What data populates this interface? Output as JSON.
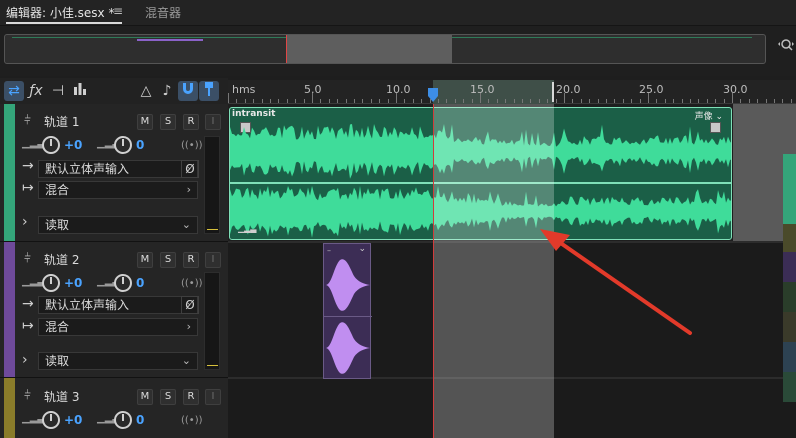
{
  "tabs": {
    "editor_label": "编辑器: 小佳.sesx *",
    "menu_icon": "≡",
    "mixer_label": "混音器"
  },
  "toolbar": {
    "icons": [
      "swap-icon",
      "fx-icon",
      "send-icon",
      "eq-bars-icon",
      "metronome-icon",
      "pitch-icon",
      "snap-icon",
      "marker-icon"
    ]
  },
  "ruler": {
    "unit": "hms",
    "labels": [
      "5.0",
      "10.0",
      "15.0",
      "20.0",
      "25.0",
      "30.0"
    ]
  },
  "tracks": [
    {
      "name": "轨道 1",
      "color": "#34a57a",
      "volume": "+0",
      "pan": "0",
      "input": "默认立体声输入",
      "output": "混合",
      "automation": "读取",
      "buttons": [
        "M",
        "S",
        "R",
        "I"
      ],
      "phase": "Ø"
    },
    {
      "name": "轨道 2",
      "color": "#6e4a9a",
      "volume": "+0",
      "pan": "0",
      "input": "默认立体声输入",
      "output": "混合",
      "automation": "读取",
      "buttons": [
        "M",
        "S",
        "R",
        "I"
      ],
      "phase": "Ø"
    },
    {
      "name": "轨道 3",
      "color": "#8a7c2a",
      "volume": "+0",
      "pan": "0",
      "buttons": [
        "M",
        "S",
        "R",
        "I"
      ]
    }
  ],
  "clips": {
    "clip1_name": "intransit",
    "clip1_voice": "声像"
  },
  "colors": {
    "clip1_wave": "#3fdc9a",
    "clip2_wave": "#c08ef0",
    "accent": "#4aa3ff",
    "playhead": "#e04646"
  }
}
